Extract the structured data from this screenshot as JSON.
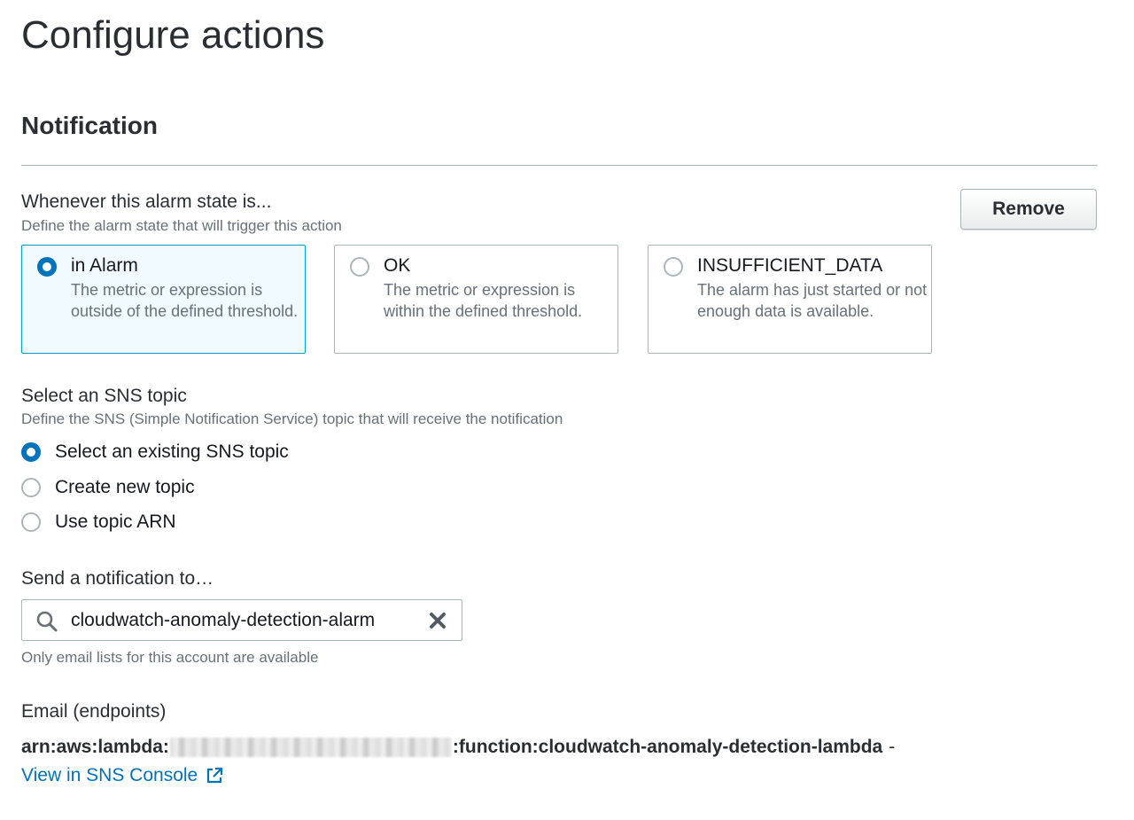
{
  "page": {
    "title": "Configure actions"
  },
  "notification": {
    "section_title": "Notification",
    "remove_label": "Remove",
    "alarm_state": {
      "label": "Whenever this alarm state is...",
      "description": "Define the alarm state that will trigger this action",
      "selected": "in Alarm",
      "options": [
        {
          "label": "in Alarm",
          "description": "The metric or expression is outside of the defined threshold."
        },
        {
          "label": "OK",
          "description": "The metric or expression is within the defined threshold."
        },
        {
          "label": "INSUFFICIENT_DATA",
          "description": "The alarm has just started or not enough data is available."
        }
      ]
    },
    "sns_topic": {
      "label": "Select an SNS topic",
      "description": "Define the SNS (Simple Notification Service) topic that will receive the notification",
      "selected": "Select an existing SNS topic",
      "options": [
        {
          "label": "Select an existing SNS topic"
        },
        {
          "label": "Create new topic"
        },
        {
          "label": "Use topic ARN"
        }
      ]
    },
    "send_to": {
      "label": "Send a notification to…",
      "value": "cloudwatch-anomaly-detection-alarm",
      "hint": "Only email lists for this account are available"
    },
    "endpoints": {
      "label": "Email (endpoints)",
      "arn_prefix": "arn:aws:lambda:",
      "arn_suffix": ":function:cloudwatch-anomaly-detection-lambda",
      "separator": "-",
      "link_label": "View in SNS Console"
    }
  },
  "colors": {
    "accent": "#0073bb",
    "selected_tile_border": "#00a1c9",
    "selected_tile_background": "#f1faff",
    "muted_text": "#687078",
    "border": "#aab7b8"
  },
  "icons": {
    "search": "search-icon",
    "clear": "close-icon",
    "external_link": "external-link-icon"
  }
}
